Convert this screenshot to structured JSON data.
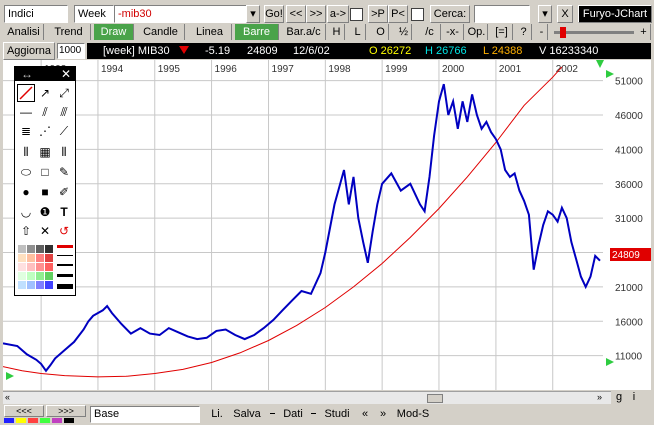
{
  "toolbar": {
    "indici": "Indici",
    "period": "Week",
    "symbol": "-mib30",
    "go": "Go!",
    "nav_prev": "<<",
    "nav_next": ">>",
    "a_btn": "a->",
    "p_btn": ">P",
    "pk_btn": "P<",
    "cerca_label": "Cerca:",
    "cerca_value": "",
    "close": "X",
    "app": "Furyo-JChart"
  },
  "tabs": {
    "analisi": "Analisi",
    "trend": "Trend",
    "draw": "Draw",
    "candle": "Candle",
    "linea": "Linea",
    "barre": "Barre",
    "bar_ac": "Bar.a/c",
    "h": "H",
    "l": "L",
    "o": "O",
    "half": "½",
    "c": "/c",
    "x": "-x-",
    "op": "Op.",
    "eq": "[=]",
    "q": "?",
    "minus": "-",
    "plus": "+"
  },
  "aggiorna": {
    "label": "Aggiorna",
    "value": "1000"
  },
  "info": {
    "label": "[week] MIB30",
    "change": "-5.19",
    "last": "24809",
    "date": "12/6/02",
    "open": "O 26272",
    "high": "H 26766",
    "low": "L 24388",
    "volume": "V 16233340"
  },
  "colors": {
    "price": "#0000c0",
    "trend": "#e00000",
    "open": "#ffff00",
    "high": "#00e5e5",
    "low": "#ffb000",
    "lastbg": "#e00000",
    "green": "#4aa34a"
  },
  "chart_data": {
    "type": "line",
    "series": [
      {
        "values": [
          [
            "1992-05-01",
            12800
          ],
          [
            "1992-08-01",
            12400
          ],
          [
            "1992-10-01",
            11200
          ],
          [
            "1992-12-01",
            10400
          ],
          [
            "1993-01-01",
            9800
          ],
          [
            "1993-02-01",
            8800
          ],
          [
            "1993-03-01",
            9600
          ],
          [
            "1993-04-01",
            10600
          ],
          [
            "1993-06-01",
            11800
          ],
          [
            "1993-08-01",
            13000
          ],
          [
            "1993-10-01",
            14800
          ],
          [
            "1993-11-01",
            16000
          ],
          [
            "1993-12-01",
            16800
          ],
          [
            "1994-02-01",
            17600
          ],
          [
            "1994-03-01",
            18200
          ],
          [
            "1994-04-01",
            17200
          ],
          [
            "1994-06-01",
            15600
          ],
          [
            "1994-08-01",
            14200
          ],
          [
            "1994-10-01",
            15000
          ],
          [
            "1994-12-01",
            14200
          ],
          [
            "1995-02-01",
            14000
          ],
          [
            "1995-04-01",
            15000
          ],
          [
            "1995-06-01",
            14400
          ],
          [
            "1995-08-01",
            13800
          ],
          [
            "1995-10-01",
            13400
          ],
          [
            "1995-12-01",
            13600
          ],
          [
            "1996-02-01",
            14600
          ],
          [
            "1996-04-01",
            14800
          ],
          [
            "1996-06-01",
            14000
          ],
          [
            "1996-08-01",
            13400
          ],
          [
            "1996-10-01",
            14000
          ],
          [
            "1996-12-01",
            15000
          ],
          [
            "1997-02-01",
            16200
          ],
          [
            "1997-04-01",
            17600
          ],
          [
            "1997-06-01",
            19000
          ],
          [
            "1997-08-01",
            20400
          ],
          [
            "1997-10-01",
            20000
          ],
          [
            "1997-12-01",
            23000
          ],
          [
            "1998-01-01",
            26000
          ],
          [
            "1998-03-01",
            33000
          ],
          [
            "1998-05-01",
            38000
          ],
          [
            "1998-06-01",
            33000
          ],
          [
            "1998-07-01",
            37000
          ],
          [
            "1998-08-01",
            31000
          ],
          [
            "1998-09-01",
            27500
          ],
          [
            "1998-10-01",
            24500
          ],
          [
            "1998-11-01",
            29000
          ],
          [
            "1998-12-01",
            33000
          ],
          [
            "1999-01-01",
            36000
          ],
          [
            "1999-03-01",
            37500
          ],
          [
            "1999-05-01",
            35000
          ],
          [
            "1999-07-01",
            36000
          ],
          [
            "1999-09-01",
            33000
          ],
          [
            "1999-10-01",
            32000
          ],
          [
            "1999-11-01",
            37000
          ],
          [
            "1999-12-01",
            43000
          ],
          [
            "2000-01-01",
            48000
          ],
          [
            "2000-02-01",
            50500
          ],
          [
            "2000-03-01",
            46000
          ],
          [
            "2000-04-01",
            48000
          ],
          [
            "2000-05-01",
            44000
          ],
          [
            "2000-06-01",
            48000
          ],
          [
            "2000-07-01",
            45000
          ],
          [
            "2000-08-01",
            49000
          ],
          [
            "2000-09-01",
            46000
          ],
          [
            "2000-10-01",
            44000
          ],
          [
            "2000-11-01",
            45000
          ],
          [
            "2000-12-01",
            43500
          ],
          [
            "2001-01-01",
            42500
          ],
          [
            "2001-02-01",
            41000
          ],
          [
            "2001-03-01",
            38000
          ],
          [
            "2001-04-01",
            37000
          ],
          [
            "2001-05-01",
            37500
          ],
          [
            "2001-06-01",
            35000
          ],
          [
            "2001-07-01",
            33500
          ],
          [
            "2001-08-01",
            31500
          ],
          [
            "2001-09-01",
            23500
          ],
          [
            "2001-10-01",
            27000
          ],
          [
            "2001-11-01",
            30000
          ],
          [
            "2001-12-01",
            32000
          ],
          [
            "2002-01-01",
            31500
          ],
          [
            "2002-02-01",
            30500
          ],
          [
            "2002-03-01",
            32500
          ],
          [
            "2002-04-01",
            31000
          ],
          [
            "2002-05-01",
            27500
          ],
          [
            "2002-06-01",
            25000
          ],
          [
            "2002-07-01",
            22500
          ],
          [
            "2002-08-01",
            21000
          ],
          [
            "2002-09-01",
            22500
          ],
          [
            "2002-10-01",
            25500
          ],
          [
            "2002-11-01",
            24809
          ]
        ]
      },
      {
        "values": [
          [
            "1992-05-01",
            9400
          ],
          [
            "1992-09-01",
            8800
          ],
          [
            "1993-01-01",
            8400
          ],
          [
            "1993-06-01",
            8100
          ],
          [
            "1994-01-01",
            7900
          ],
          [
            "1994-07-01",
            8000
          ],
          [
            "1995-01-01",
            8400
          ],
          [
            "1995-07-01",
            9000
          ],
          [
            "1996-01-01",
            10000
          ],
          [
            "1996-07-01",
            11400
          ],
          [
            "1997-01-01",
            13200
          ],
          [
            "1997-07-01",
            15400
          ],
          [
            "1998-01-01",
            18000
          ],
          [
            "1998-07-01",
            21000
          ],
          [
            "1999-01-01",
            24400
          ],
          [
            "1999-07-01",
            28200
          ],
          [
            "2000-01-01",
            32400
          ],
          [
            "2000-07-01",
            37000
          ],
          [
            "2001-01-01",
            42000
          ],
          [
            "2001-07-01",
            47400
          ],
          [
            "2002-01-01",
            51500
          ],
          [
            "2002-03-01",
            53000
          ]
        ]
      }
    ],
    "x_ticks": [
      "1993",
      "1994",
      "1995",
      "1996",
      "1997",
      "1998",
      "1999",
      "2000",
      "2001",
      "2002"
    ],
    "y_ticks": [
      "51000",
      "46000",
      "41000",
      "36000",
      "31000",
      "26000",
      "21000",
      "16000",
      "11000"
    ],
    "ylim": [
      6000,
      54000
    ],
    "last_label": "24809"
  },
  "palette": {
    "icons": [
      "arrows-icon",
      "close-icon",
      "line-icon",
      "arrow-ne-icon",
      "double-arrow-icon",
      "hline-icon",
      "parallel-icon",
      "channel-icon",
      "lines-icon",
      "fan-icon",
      "fib-fan-icon",
      "vlines-icon",
      "grid-icon",
      "cycles-icon",
      "ellipse-icon",
      "rect-icon",
      "pen-icon",
      "circle-fill-icon",
      "square-fill-icon",
      "pencil-icon",
      "arc-icon",
      "info-icon",
      "text-icon",
      "up-icon",
      "move-icon",
      "undo-icon"
    ],
    "colors": [
      "#c0c0c0",
      "#909090",
      "#606060",
      "#303030",
      "#ffe0c0",
      "#ffc0a0",
      "#ff8080",
      "#e04040",
      "#ffe0e0",
      "#ffc0c0",
      "#ff9090",
      "#ff6060",
      "#e0ffe0",
      "#c0ffc0",
      "#90ee90",
      "#60d060",
      "#c0e0ff",
      "#a0c0ff",
      "#8080ff",
      "#4040ff"
    ]
  },
  "bottom": {
    "nav_first": "<<<",
    "nav_last": ">>>",
    "base": "Base",
    "li": "Li.",
    "salva": "Salva",
    "dati": "Dati",
    "studi": "Studi",
    "prev": "«",
    "next": "»",
    "mods": "Mod-S",
    "g": "g",
    "i": "i"
  }
}
